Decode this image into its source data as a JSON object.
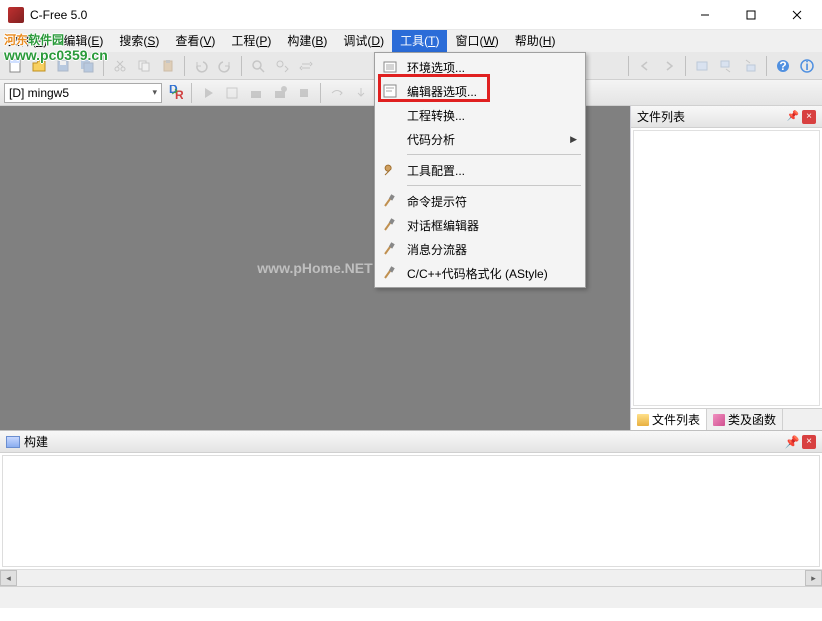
{
  "window": {
    "title": "C-Free 5.0"
  },
  "menu": {
    "file": "文件(F)",
    "edit": "编辑(E)",
    "search": "搜索(S)",
    "view": "查看(V)",
    "project": "工程(P)",
    "build": "构建(B)",
    "debug": "调试(D)",
    "tools": "工具(T)",
    "window": "窗口(W)",
    "help": "帮助(H)"
  },
  "toolbar2": {
    "compiler": "[D] mingw5"
  },
  "dropdown": {
    "env_options": "环境选项...",
    "editor_options": "编辑器选项...",
    "project_convert": "工程转换...",
    "code_analysis": "代码分析",
    "tool_config": "工具配置...",
    "cmd_prompt": "命令提示符",
    "dialog_editor": "对话框编辑器",
    "msg_splitter": "消息分流器",
    "astyle": "C/C++代码格式化 (AStyle)"
  },
  "right_panel": {
    "title": "文件列表",
    "tab1": "文件列表",
    "tab2": "类及函数"
  },
  "bottom_panel": {
    "title": "构建"
  },
  "watermark": {
    "site_cn": "河东软件园",
    "site_url": "www.pc0359.cn",
    "center": "www.pHome.NET"
  }
}
